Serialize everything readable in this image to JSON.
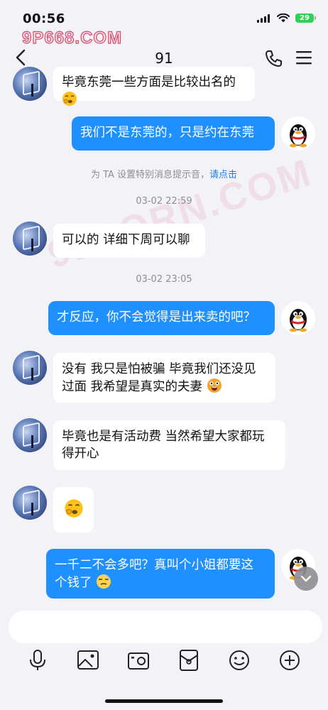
{
  "status_bar": {
    "time": "00:56",
    "battery": "29"
  },
  "watermark": "9P668.COM",
  "big_watermark": "91PORN.COM",
  "header": {
    "title": "91"
  },
  "messages": [
    {
      "side": "in",
      "text": "毕竟东莞一些方面是比较出名的",
      "emoji": "yawn-emoji"
    },
    {
      "side": "out",
      "text": "我们不是东莞的，只是约在东莞"
    },
    {
      "type": "notice",
      "text": "为 TA 设置特别消息提示音，",
      "link": "请点击"
    },
    {
      "type": "time",
      "text": "03-02 22:59"
    },
    {
      "side": "in",
      "text": "可以的 详细下周可以聊"
    },
    {
      "type": "time",
      "text": "03-02 23:05"
    },
    {
      "side": "out",
      "text": "才反应，你不会觉得是出来卖的吧？"
    },
    {
      "side": "in",
      "line1": "没有 我只是怕被骗 毕竟我们还没见",
      "line2": "过面 我希望是真实的夫妻",
      "emoji": "shocked-emoji"
    },
    {
      "side": "in",
      "line1": "毕竟也是有活动费 当然希望大家都玩",
      "line2": "得开心"
    },
    {
      "side": "in",
      "emoji": "yawn-emoji"
    },
    {
      "side": "out",
      "line1": "一千二不会多吧？真叫个小姐都要这",
      "line2": "个钱了",
      "emoji": "smirk-emoji"
    }
  ],
  "input": {
    "value": "",
    "placeholder": ""
  },
  "colors": {
    "accent": "#1e90ff",
    "incoming": "#ffffff",
    "background": "#f2f2f7"
  },
  "toolbar_icons": [
    "microphone-icon",
    "photo-icon",
    "camera-icon",
    "red-packet-icon",
    "emoji-icon",
    "plus-icon"
  ]
}
